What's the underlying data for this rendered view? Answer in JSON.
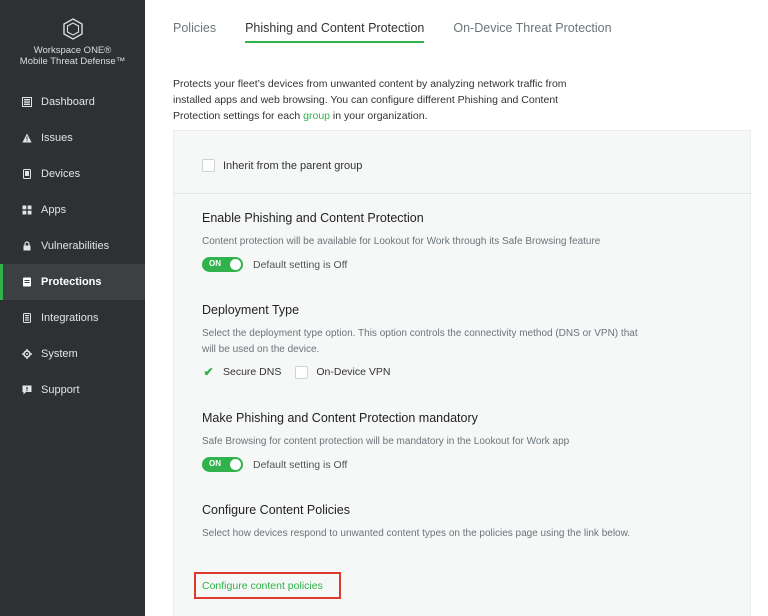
{
  "brand": {
    "line1": "Workspace ONE®",
    "line2": "Mobile Threat Defense™"
  },
  "nav": [
    {
      "label": "Dashboard",
      "icon": "dashboard-icon",
      "active": false
    },
    {
      "label": "Issues",
      "icon": "warning-icon",
      "active": false
    },
    {
      "label": "Devices",
      "icon": "device-icon",
      "active": false
    },
    {
      "label": "Apps",
      "icon": "apps-grid-icon",
      "active": false
    },
    {
      "label": "Vulnerabilities",
      "icon": "lock-icon",
      "active": false
    },
    {
      "label": "Protections",
      "icon": "protections-icon",
      "active": true
    },
    {
      "label": "Integrations",
      "icon": "integrations-icon",
      "active": false
    },
    {
      "label": "System",
      "icon": "gear-icon",
      "active": false
    },
    {
      "label": "Support",
      "icon": "support-chat-icon",
      "active": false
    }
  ],
  "tabs": [
    {
      "label": "Policies",
      "active": false
    },
    {
      "label": "Phishing and Content Protection",
      "active": true
    },
    {
      "label": "On-Device Threat Protection",
      "active": false
    }
  ],
  "intro": {
    "before": "Protects your fleet’s devices from unwanted content by analyzing network traffic from installed apps and web browsing. You can configure different Phishing and Content Protection settings for each ",
    "link": "group",
    "after": " in your organization."
  },
  "inherit": {
    "label": "Inherit from the parent group",
    "checked": false
  },
  "enable": {
    "title": "Enable Phishing and Content Protection",
    "desc": "Content protection will be available for Lookout for Work through its Safe Browsing feature",
    "toggle": "ON",
    "default_text": "Default setting is Off"
  },
  "deployment": {
    "title": "Deployment Type",
    "desc": "Select the deployment type option. This option controls the connectivity method (DNS or VPN) that will be used on the device.",
    "options": [
      {
        "label": "Secure DNS",
        "checked": true
      },
      {
        "label": "On-Device VPN",
        "checked": false
      }
    ]
  },
  "mandatory": {
    "title": "Make Phishing and Content Protection mandatory",
    "desc": "Safe Browsing for content protection will be mandatory in the Lookout for Work app",
    "toggle": "ON",
    "default_text": "Default setting is Off"
  },
  "configure": {
    "title": "Configure Content Policies",
    "desc": "Select how devices respond to unwanted content types on the policies page using the link below.",
    "link": "Configure content policies"
  },
  "colors": {
    "accent": "#2fb34a",
    "sidebar": "#2e3133",
    "highlight": "#e03a2f"
  }
}
